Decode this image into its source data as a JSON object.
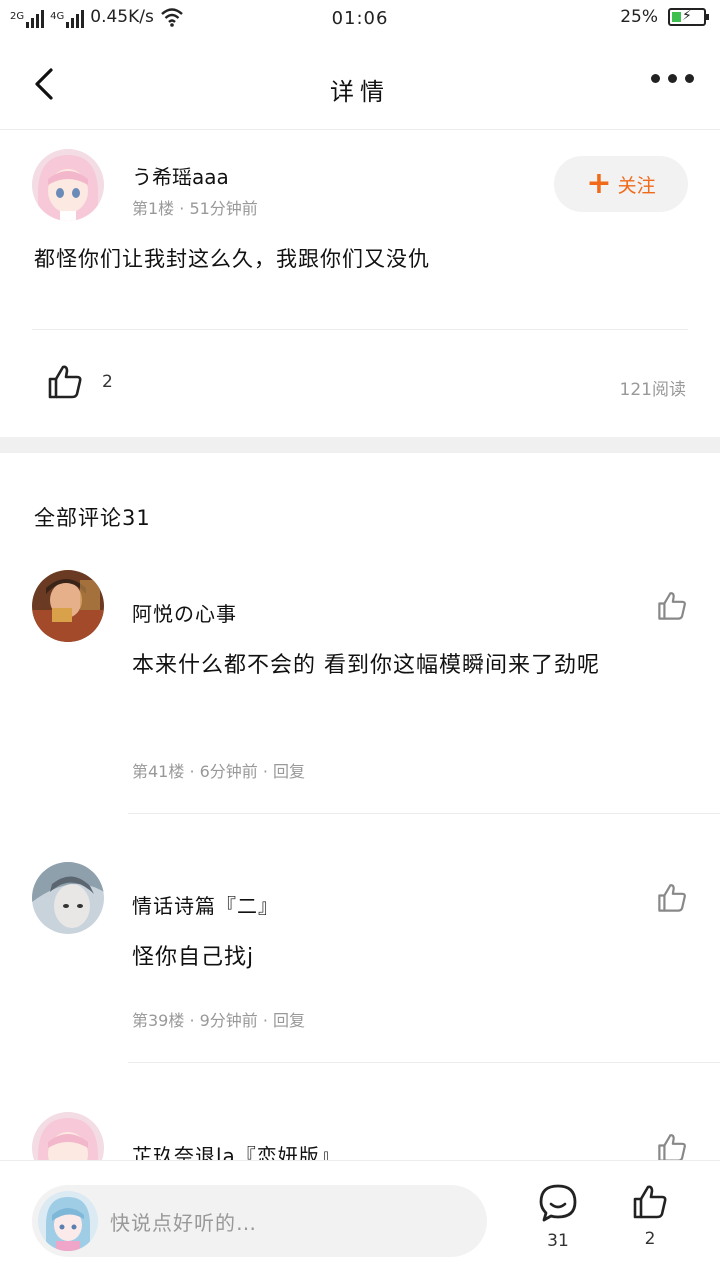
{
  "status_bar": {
    "net1": "2G",
    "net2": "4G",
    "speed": "0.45K/s",
    "time": "01:06",
    "battery": "25%"
  },
  "nav": {
    "title": "详情"
  },
  "post": {
    "author": "う希瑶aaa",
    "meta": "第1楼 · 51分钟前",
    "follow_label": "关注",
    "content": "都怪你们让我封这么久，我跟你们又没仇",
    "likes": "2",
    "reads": "121阅读"
  },
  "comments_header": "全部评论31",
  "comments": [
    {
      "name": "阿悦の心事",
      "text": "本来什么都不会的 看到你这幅模瞬间来了劲呢",
      "meta": "第41楼 · 6分钟前 · 回复"
    },
    {
      "name": "情话诗篇『二』",
      "text": "怪你自己找j",
      "meta": "第39楼 · 9分钟前 · 回复"
    },
    {
      "name": "芷玖奈退la『恋妍版』",
      "text": "",
      "meta": ""
    }
  ],
  "bottom_bar": {
    "placeholder": "快说点好听的…",
    "comment_count": "31",
    "like_count": "2"
  },
  "colors": {
    "accent": "#f06a1a",
    "divider": "#ececec",
    "muted_text": "#999999"
  }
}
